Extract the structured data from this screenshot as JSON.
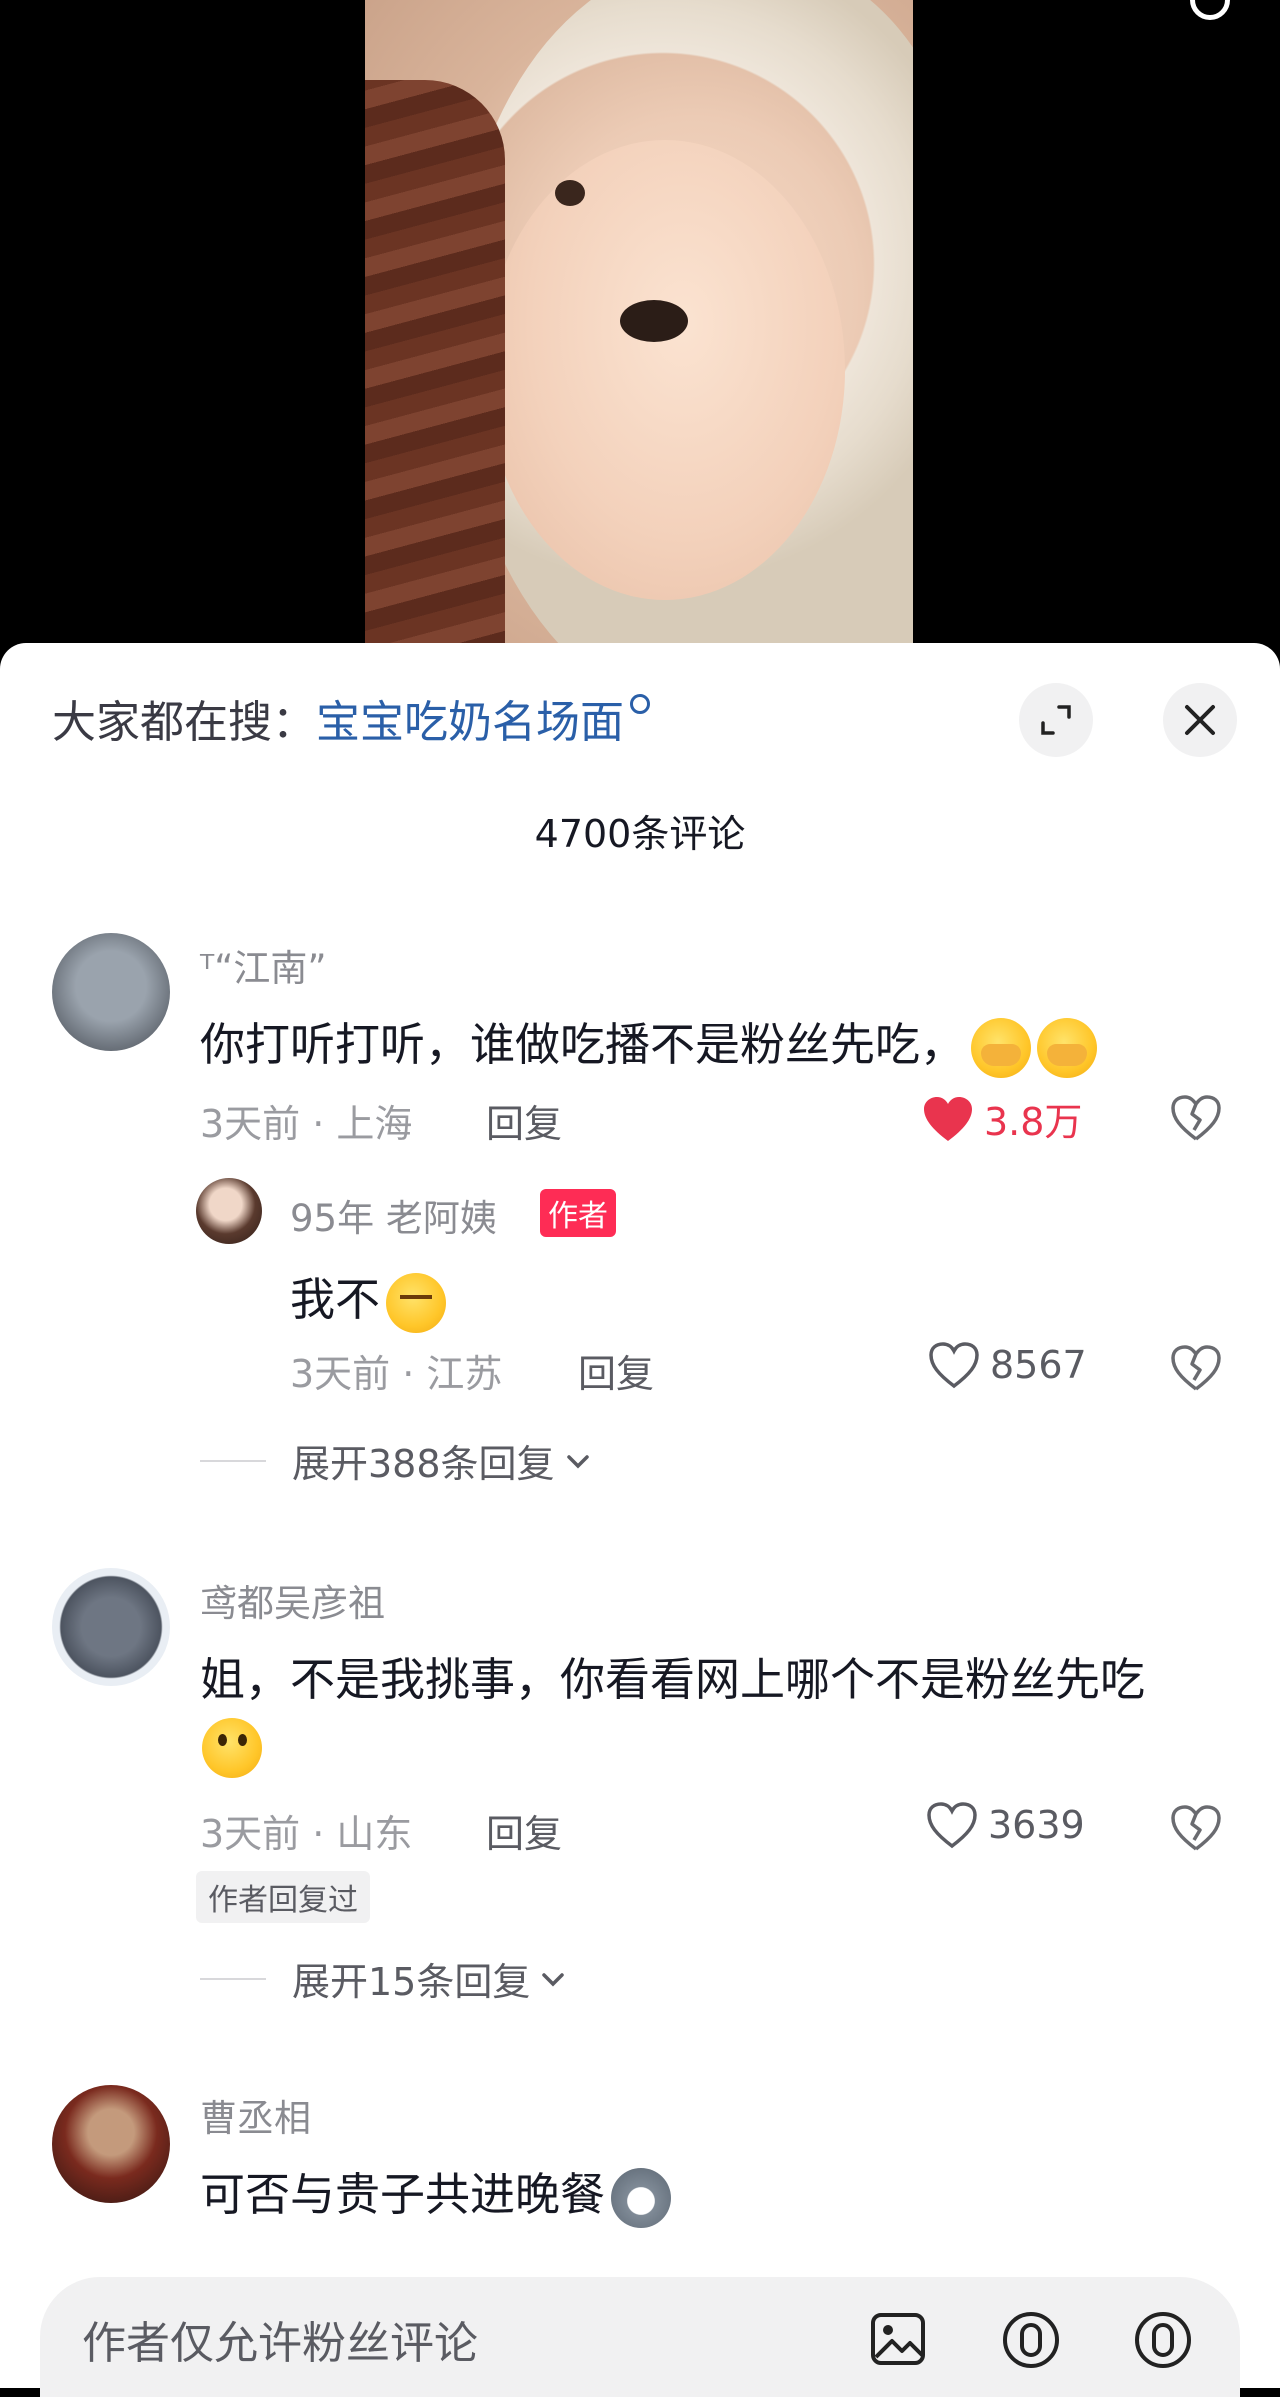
{
  "header": {
    "hot_search_prefix": "大家都在搜：",
    "hot_search_term": "宝宝吃奶名场面",
    "comment_count": "4700条评论"
  },
  "comments": [
    {
      "username": "ᵀ“江南”",
      "text": "你打听打听，谁做吃播不是粉丝先吃，",
      "meta": "3天前 · 上海",
      "reply_label": "回复",
      "likes": "3.8万",
      "liked": true,
      "replies": [
        {
          "username": "95年 老阿姨",
          "badge": "作者",
          "text": "我不",
          "meta": "3天前 · 江苏",
          "reply_label": "回复",
          "likes": "8567"
        }
      ],
      "expand_label": "展开388条回复"
    },
    {
      "username": "鸢都吴彦祖",
      "text_line1": "姐，不是我挑事，你看看网上哪个不是粉丝先吃",
      "meta": "3天前 · 山东",
      "reply_label": "回复",
      "likes": "3639",
      "tag": "作者回复过",
      "expand_label": "展开15条回复"
    },
    {
      "username": "曹丞相",
      "text": "可否与贵子共进晚餐"
    }
  ],
  "bottom_bar": {
    "placeholder": "作者仅允许粉丝评论"
  },
  "colors": {
    "accent_red": "#fe2c55",
    "like_red": "#e9344e",
    "link_blue": "#2a5fa8"
  }
}
